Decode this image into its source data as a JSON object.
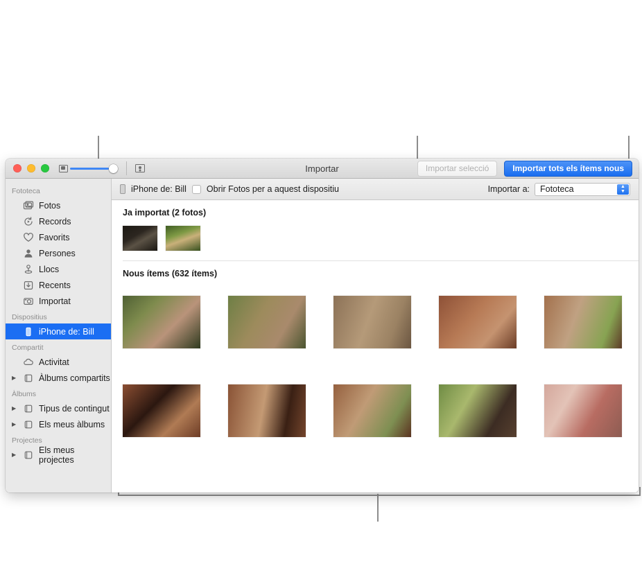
{
  "window": {
    "title": "Importar",
    "traffic_lights": [
      "close",
      "minimize",
      "zoom"
    ],
    "toolbar": {
      "zoom_slider_value": 72,
      "thumbnail_icon": "thumbnail-size-icon",
      "people_icon": "people-view-icon",
      "import_selection_label": "Importar selecció",
      "import_selection_enabled": false,
      "import_all_label": "Importar tots els ítems nous",
      "accent_color": "#1a6ef0"
    }
  },
  "sidebar": {
    "sections": [
      {
        "header": "Fototeca",
        "items": [
          {
            "label": "Fotos",
            "icon": "photos-icon",
            "disclosure": false,
            "selected": false
          },
          {
            "label": "Records",
            "icon": "memories-icon",
            "disclosure": false,
            "selected": false
          },
          {
            "label": "Favorits",
            "icon": "heart-icon",
            "disclosure": false,
            "selected": false
          },
          {
            "label": "Persones",
            "icon": "person-icon",
            "disclosure": false,
            "selected": false
          },
          {
            "label": "Llocs",
            "icon": "places-pin-icon",
            "disclosure": false,
            "selected": false
          },
          {
            "label": "Recents",
            "icon": "recents-download-icon",
            "disclosure": false,
            "selected": false
          },
          {
            "label": "Importat",
            "icon": "imported-camera-icon",
            "disclosure": false,
            "selected": false
          }
        ]
      },
      {
        "header": "Dispositius",
        "items": [
          {
            "label": "iPhone de: Bill",
            "icon": "iphone-icon",
            "disclosure": false,
            "selected": true
          }
        ]
      },
      {
        "header": "Compartit",
        "items": [
          {
            "label": "Activitat",
            "icon": "cloud-icon",
            "disclosure": false,
            "selected": false
          },
          {
            "label": "Àlbums compartits",
            "icon": "album-icon",
            "disclosure": true,
            "selected": false
          }
        ]
      },
      {
        "header": "Àlbums",
        "items": [
          {
            "label": "Tipus de contingut",
            "icon": "album-icon",
            "disclosure": true,
            "selected": false
          },
          {
            "label": "Els meus àlbums",
            "icon": "album-icon",
            "disclosure": true,
            "selected": false
          }
        ]
      },
      {
        "header": "Projectes",
        "items": [
          {
            "label": "Els meus projectes",
            "icon": "album-icon",
            "disclosure": true,
            "selected": false
          }
        ]
      }
    ]
  },
  "device_bar": {
    "device_icon": "iphone-icon",
    "device_name": "iPhone de: Bill",
    "open_photos_checkbox_label": "Obrir Fotos per a aquest dispositiu",
    "open_photos_checked": false,
    "import_to_label": "Importar a:",
    "import_to_value": "Fototeca",
    "import_to_options": [
      "Fototeca"
    ]
  },
  "main": {
    "already_imported": {
      "title": "Ja importat (2 fotos)",
      "count": 2,
      "thumbnails": [
        {
          "alt": "man-at-cafe-counter",
          "c1": "#2b2319",
          "c2": "#6d5f4a",
          "c3": "#4a4036"
        },
        {
          "alt": "man-in-garden-smiling",
          "c1": "#5e7a3a",
          "c2": "#9bb05f",
          "c3": "#3d5226"
        }
      ]
    },
    "new_items": {
      "title": "Nous ítems (632 ítems)",
      "count": 632,
      "thumbnails": [
        {
          "alt": "woman-hiking-closeup",
          "c1": "#6f7d4a",
          "c2": "#b39277",
          "c3": "#3e4a26"
        },
        {
          "alt": "couple-walking-path",
          "c1": "#7c8a4e",
          "c2": "#a9895f",
          "c3": "#4a5530"
        },
        {
          "alt": "group-at-temple",
          "c1": "#9c7f63",
          "c2": "#b9a07f",
          "c3": "#6d5a44"
        },
        {
          "alt": "three-friends-sitting-ruins",
          "c1": "#a05f42",
          "c2": "#c08a62",
          "c3": "#6d4029"
        },
        {
          "alt": "woman-walking-temple-lawn",
          "c1": "#a8714f",
          "c2": "#8fa054",
          "c3": "#6f4630"
        },
        {
          "alt": "woman-in-temple-doorway",
          "c1": "#8a4f33",
          "c2": "#b27a53",
          "c3": "#52291a"
        },
        {
          "alt": "two-people-stone-corridor",
          "c1": "#8c5537",
          "c2": "#c49470",
          "c3": "#4b2616"
        },
        {
          "alt": "woman-with-umbrella-ruins",
          "c1": "#9a6142",
          "c2": "#bd9470",
          "c3": "#5a3020"
        },
        {
          "alt": "couple-on-lawn-picnic",
          "c1": "#6f8a42",
          "c2": "#9fae63",
          "c3": "#3c2b22"
        },
        {
          "alt": "two-women-at-market",
          "c1": "#c9897d",
          "c2": "#ddb6ab",
          "c3": "#8a5a52"
        }
      ]
    }
  },
  "callouts": [
    {
      "name": "sidebar-callout-bracket",
      "target": "already-imported-section"
    },
    {
      "name": "import-selection-callout",
      "target": "import-selection-button"
    },
    {
      "name": "import-all-callout",
      "target": "import-all-button"
    },
    {
      "name": "new-items-callout-bracket",
      "target": "new-items-grid"
    }
  ]
}
